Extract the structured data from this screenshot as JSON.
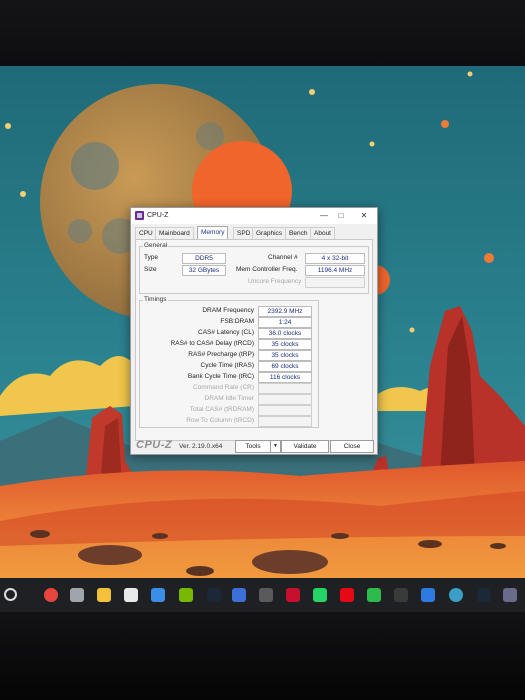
{
  "window": {
    "title": "CPU-Z",
    "controls": {
      "minimize": "—",
      "maximize": "□",
      "close": "✕"
    },
    "icon": "cpuz-app-icon"
  },
  "tabs": [
    {
      "label": "CPU"
    },
    {
      "label": "Mainboard"
    },
    {
      "label": "Memory",
      "active": true
    },
    {
      "label": "SPD"
    },
    {
      "label": "Graphics"
    },
    {
      "label": "Bench"
    },
    {
      "label": "About"
    }
  ],
  "general": {
    "title": "General",
    "type_label": "Type",
    "type_value": "DDR5",
    "size_label": "Size",
    "size_value": "32 GBytes",
    "channel_label": "Channel #",
    "channel_value": "4 x 32-bit",
    "mem_ctrl_label": "Mem Controller Freq.",
    "mem_ctrl_value": "1196.4 MHz",
    "uncore_label": "Uncore Frequency",
    "uncore_value": ""
  },
  "timings": {
    "title": "Timings",
    "rows": [
      {
        "label": "DRAM Frequency",
        "value": "2392.9 MHz",
        "enabled": true
      },
      {
        "label": "FSB:DRAM",
        "value": "1:24",
        "enabled": true
      },
      {
        "label": "CAS# Latency (CL)",
        "value": "36.0 clocks",
        "enabled": true
      },
      {
        "label": "RAS# to CAS# Delay (tRCD)",
        "value": "35 clocks",
        "enabled": true
      },
      {
        "label": "RAS# Precharge (tRP)",
        "value": "35 clocks",
        "enabled": true
      },
      {
        "label": "Cycle Time (tRAS)",
        "value": "69 clocks",
        "enabled": true
      },
      {
        "label": "Bank Cycle Time (tRC)",
        "value": "116 clocks",
        "enabled": true
      },
      {
        "label": "Command Rate (CR)",
        "value": "",
        "enabled": false
      },
      {
        "label": "DRAM Idle Timer",
        "value": "",
        "enabled": false
      },
      {
        "label": "Total CAS# (tRDRAM)",
        "value": "",
        "enabled": false
      },
      {
        "label": "Row To Column (tRCD)",
        "value": "",
        "enabled": false
      }
    ]
  },
  "footer": {
    "brand": "CPU-Z",
    "version": "Ver. 2.19.0.x64",
    "tools_label": "Tools",
    "tools_arrow": "▼",
    "validate_label": "Validate",
    "close_label": "Close"
  },
  "taskbar": {
    "icons": [
      "search-icon",
      "chrome-icon",
      "settings-icon",
      "file-explorer-icon",
      "app-grid-icon",
      "store-icon",
      "nvidia-icon",
      "steam-icon",
      "app-icon",
      "g-hub-icon",
      "rog-icon",
      "whatsapp-icon",
      "netflix-icon",
      "xbox-icon",
      "davinci-icon",
      "folder-app-icon",
      "globe-icon",
      "steam-icon-2",
      "settings-icon-2"
    ]
  }
}
